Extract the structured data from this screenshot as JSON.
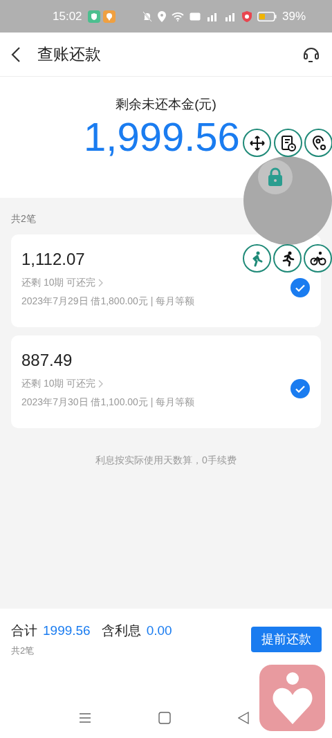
{
  "status_bar": {
    "time": "15:02",
    "battery": "39%"
  },
  "header": {
    "title": "查账还款"
  },
  "summary": {
    "label": "剩余未还本金(元)",
    "amount": "1,999.56"
  },
  "list_count": "共2笔",
  "loans": [
    {
      "amount": "1,112.07",
      "remaining": "还剩 10期 可还完",
      "details": "2023年7月29日 借1,800.00元 | 每月等额",
      "selected": true
    },
    {
      "amount": "887.49",
      "remaining": "还剩 10期 可还完",
      "details": "2023年7月30日 借1,100.00元 | 每月等额",
      "selected": true
    }
  ],
  "note": "利息按实际使用天数算，0手续费",
  "footer": {
    "total_label": "合计",
    "total": "1999.56",
    "interest_label": "含利息",
    "interest": "0.00",
    "count": "共2笔",
    "button": "提前还款"
  }
}
